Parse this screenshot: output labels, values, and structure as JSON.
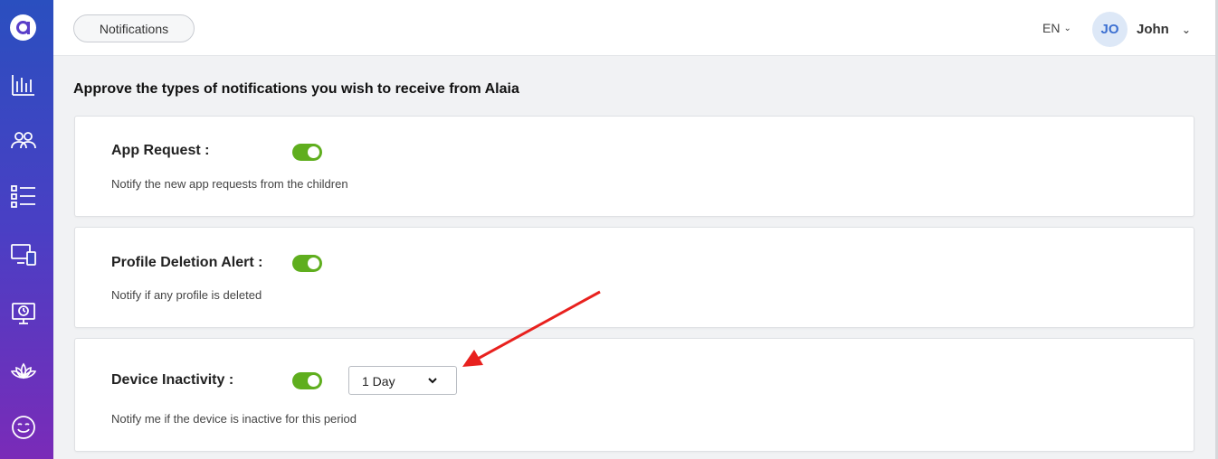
{
  "sidebar": {
    "items": [
      {
        "icon": "analytics-icon"
      },
      {
        "icon": "users-icon"
      },
      {
        "icon": "checklist-icon"
      },
      {
        "icon": "devices-icon"
      },
      {
        "icon": "screen-time-icon"
      },
      {
        "icon": "lotus-icon"
      },
      {
        "icon": "smiley-icon"
      }
    ]
  },
  "header": {
    "tab_label": "Notifications",
    "language": "EN",
    "avatar_initials": "JO",
    "user_name": "John"
  },
  "main": {
    "heading": "Approve the types of notifications you wish to receive from Alaia",
    "cards": [
      {
        "title": "App Request :",
        "description": "Notify the new app requests from the children",
        "enabled": true
      },
      {
        "title": "Profile Deletion Alert :",
        "description": "Notify if any profile is deleted",
        "enabled": true
      },
      {
        "title": "Device Inactivity :",
        "description": "Notify me if the device is inactive for this period",
        "enabled": true,
        "period": "1 Day"
      }
    ]
  },
  "colors": {
    "accent_toggle": "#5fae1e",
    "sidebar_top": "#2a4fbf",
    "sidebar_bottom": "#7a2bb8",
    "annotation_arrow": "#e8211e"
  }
}
